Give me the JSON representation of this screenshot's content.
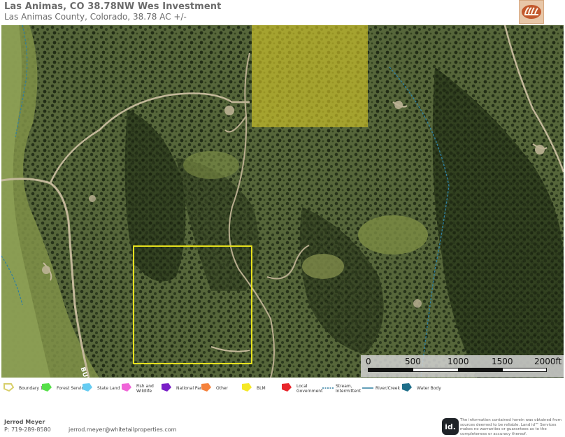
{
  "header": {
    "title": "Las Animas, CO 38.78NW Wes Investment",
    "subtitle": "Las Animas County, Colorado, 38.78 AC +/-"
  },
  "map": {
    "road_label": "BUR",
    "scale": {
      "labels": [
        "0",
        "500",
        "1000",
        "1500",
        "2000ft"
      ]
    }
  },
  "legend": {
    "items": [
      {
        "label": "Boundary 1",
        "color": "#d8cf6a",
        "icon": "boundary-swatch"
      },
      {
        "label": "Forest Servic",
        "color": "#56e04a",
        "icon": "forest-service-swatch"
      },
      {
        "label": "State Land",
        "color": "#66ccf2",
        "icon": "state-land-swatch"
      },
      {
        "label": "Fish and\nWildlife",
        "color": "#f066d8",
        "icon": "fish-wildlife-swatch"
      },
      {
        "label": "National Parl",
        "color": "#7a1fc7",
        "icon": "national-park-swatch"
      },
      {
        "label": "Other",
        "color": "#f5823c",
        "icon": "other-swatch"
      },
      {
        "label": "BLM",
        "color": "#f5e826",
        "icon": "blm-swatch"
      },
      {
        "label": "Local\nGovernment",
        "color": "#e8262c",
        "icon": "local-government-swatch"
      },
      {
        "label": "Stream,\nIntermittent",
        "color": "#2f7fa0",
        "icon": "stream-intermittent-swatch"
      },
      {
        "label": "River/Creek",
        "color": "#2f7fa0",
        "icon": "river-creek-swatch"
      },
      {
        "label": "Water Body",
        "color": "#1f6f8a",
        "icon": "water-body-swatch"
      }
    ]
  },
  "footer": {
    "agent_name": "Jerrod Meyer",
    "phone": "P: 719-289-8580",
    "email": "jerrod.meyer@whitetailproperties.com",
    "id_logo": "id.",
    "disclaimer": "The information contained herein was obtained from sources deemed to be reliable. Land id™ Services makes no warranties or guarantees as to the completeness or accuracy thereof."
  }
}
